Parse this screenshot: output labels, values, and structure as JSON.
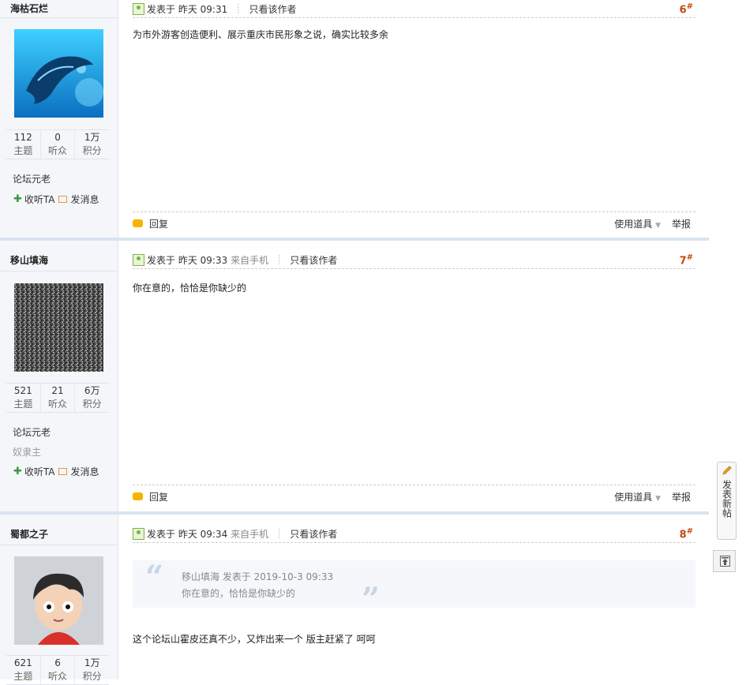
{
  "posts": [
    {
      "username": "海枯石烂",
      "stats": [
        {
          "num": "112",
          "label": "主题"
        },
        {
          "num": "0",
          "label": "听众"
        },
        {
          "num": "1万",
          "label": "积分"
        }
      ],
      "rank": "论坛元老",
      "rank2": "",
      "follow": "收听TA",
      "message": "发消息",
      "posted": "发表于",
      "time": "昨天 09:31",
      "mobile": "",
      "only_author": "只看该作者",
      "floor": "6",
      "content": "为市外游客创造便利、展示重庆市民形象之说，确实比较多余",
      "reply": "回复",
      "tools": "使用道具",
      "report": "举报"
    },
    {
      "username": "移山填海",
      "stats": [
        {
          "num": "521",
          "label": "主题"
        },
        {
          "num": "21",
          "label": "听众"
        },
        {
          "num": "6万",
          "label": "积分"
        }
      ],
      "rank": "论坛元老",
      "rank2": "奴隶主",
      "follow": "收听TA",
      "message": "发消息",
      "posted": "发表于",
      "time": "昨天 09:33",
      "mobile": "来自手机",
      "only_author": "只看该作者",
      "floor": "7",
      "content": "你在意的，恰恰是你缺少的",
      "reply": "回复",
      "tools": "使用道具",
      "report": "举报"
    },
    {
      "username": "蜀都之子",
      "stats": [
        {
          "num": "621",
          "label": "主题"
        },
        {
          "num": "6",
          "label": "听众"
        },
        {
          "num": "1万",
          "label": "积分"
        }
      ],
      "posted": "发表于",
      "time": "昨天 09:34",
      "mobile": "来自手机",
      "only_author": "只看该作者",
      "floor": "8",
      "quote_author": "移山填海 发表于 2019-10-3 09:33",
      "quote_text": "你在意的，恰恰是你缺少的",
      "content": "这个论坛山霍皮还真不少，又炸出来一个 版主赶紧了 呵呵"
    }
  ],
  "floor_mark": "#",
  "sidebar": {
    "new_post": "发表新帖"
  },
  "icons": {
    "avatar1": "dolphin-avatar",
    "avatar2": "noise-avatar",
    "avatar3": "cartoon-boy-avatar",
    "plus": "plus-icon",
    "mail": "mail-icon",
    "user": "user-icon",
    "reply": "reply-bubble-icon",
    "edit": "pencil-icon",
    "top": "back-to-top-icon"
  }
}
